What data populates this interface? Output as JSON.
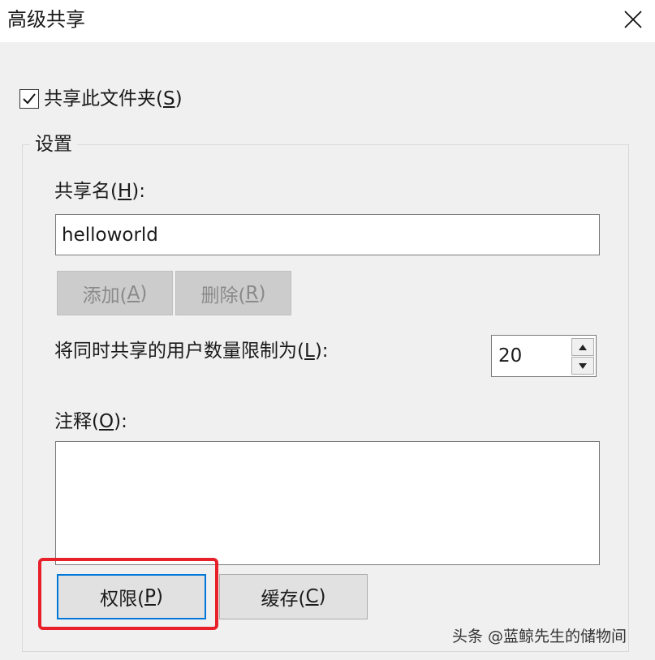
{
  "window": {
    "title": "高级共享",
    "close_icon": "close-icon"
  },
  "share_checkbox": {
    "label_prefix": "共享此文件夹(",
    "mnemonic": "S",
    "label_suffix": ")",
    "checked": true
  },
  "settings": {
    "group_label": "设置",
    "share_name": {
      "label_prefix": "共享名(",
      "mnemonic": "H",
      "label_suffix": "):",
      "value": "helloworld"
    },
    "add_button": {
      "prefix": "添加(",
      "mnemonic": "A",
      "suffix": ")",
      "disabled": true
    },
    "remove_button": {
      "prefix": "删除(",
      "mnemonic": "R",
      "suffix": ")",
      "disabled": true
    },
    "user_limit": {
      "label_prefix": "将同时共享的用户数量限制为(",
      "mnemonic": "L",
      "label_suffix": "):",
      "value": "20"
    },
    "comment": {
      "label_prefix": "注释(",
      "mnemonic": "O",
      "label_suffix": "):",
      "value": ""
    },
    "permissions_button": {
      "prefix": "权限(",
      "mnemonic": "P",
      "suffix": ")"
    },
    "caching_button": {
      "prefix": "缓存(",
      "mnemonic": "C",
      "suffix": ")"
    }
  },
  "colors": {
    "highlight": "#e8202a",
    "focus": "#0078d7"
  },
  "watermark": "头条 @蓝鲸先生的储物间"
}
